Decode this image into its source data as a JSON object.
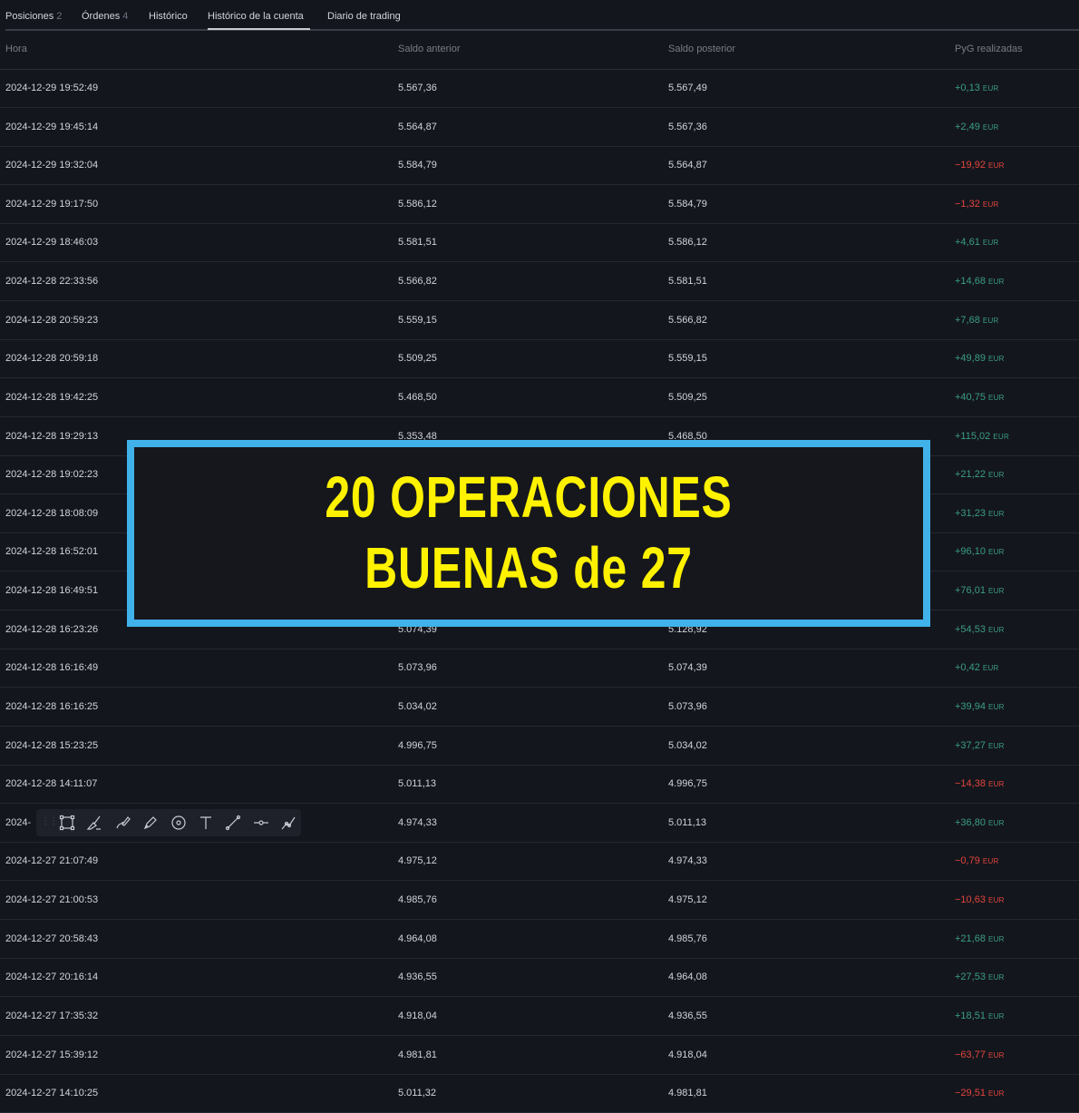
{
  "tabs": [
    {
      "label": "Posiciones",
      "count": "2"
    },
    {
      "label": "Órdenes",
      "count": "4"
    },
    {
      "label": "Histórico",
      "count": ""
    },
    {
      "label": "Histórico de la cuenta",
      "count": ""
    },
    {
      "label": "Diario de trading",
      "count": ""
    }
  ],
  "active_tab": "Histórico de la cuenta",
  "columns": [
    "Hora",
    "Saldo anterior",
    "Saldo posterior",
    "PyG realizadas"
  ],
  "currency": "EUR",
  "rows": [
    {
      "time": "2024-12-29 19:52:49",
      "before": "5.567,36",
      "after": "5.567,49",
      "pnl": "+0,13",
      "sign": "pos"
    },
    {
      "time": "2024-12-29 19:45:14",
      "before": "5.564,87",
      "after": "5.567,36",
      "pnl": "+2,49",
      "sign": "pos"
    },
    {
      "time": "2024-12-29 19:32:04",
      "before": "5.584,79",
      "after": "5.564,87",
      "pnl": "−19,92",
      "sign": "neg"
    },
    {
      "time": "2024-12-29 19:17:50",
      "before": "5.586,12",
      "after": "5.584,79",
      "pnl": "−1,32",
      "sign": "neg"
    },
    {
      "time": "2024-12-29 18:46:03",
      "before": "5.581,51",
      "after": "5.586,12",
      "pnl": "+4,61",
      "sign": "pos"
    },
    {
      "time": "2024-12-28 22:33:56",
      "before": "5.566,82",
      "after": "5.581,51",
      "pnl": "+14,68",
      "sign": "pos"
    },
    {
      "time": "2024-12-28 20:59:23",
      "before": "5.559,15",
      "after": "5.566,82",
      "pnl": "+7,68",
      "sign": "pos"
    },
    {
      "time": "2024-12-28 20:59:18",
      "before": "5.509,25",
      "after": "5.559,15",
      "pnl": "+49,89",
      "sign": "pos"
    },
    {
      "time": "2024-12-28 19:42:25",
      "before": "5.468,50",
      "after": "5.509,25",
      "pnl": "+40,75",
      "sign": "pos"
    },
    {
      "time": "2024-12-28 19:29:13",
      "before": "5.353,48",
      "after": "5.468,50",
      "pnl": "+115,02",
      "sign": "pos"
    },
    {
      "time": "2024-12-28 19:02:23",
      "before": "",
      "after": "",
      "pnl": "+21,22",
      "sign": "pos"
    },
    {
      "time": "2024-12-28 18:08:09",
      "before": "",
      "after": "",
      "pnl": "+31,23",
      "sign": "pos"
    },
    {
      "time": "2024-12-28 16:52:01",
      "before": "",
      "after": "",
      "pnl": "+96,10",
      "sign": "pos"
    },
    {
      "time": "2024-12-28 16:49:51",
      "before": "",
      "after": "",
      "pnl": "+76,01",
      "sign": "pos"
    },
    {
      "time": "2024-12-28 16:23:26",
      "before": "5.074,39",
      "after": "5.128,92",
      "pnl": "+54,53",
      "sign": "pos"
    },
    {
      "time": "2024-12-28 16:16:49",
      "before": "5.073,96",
      "after": "5.074,39",
      "pnl": "+0,42",
      "sign": "pos"
    },
    {
      "time": "2024-12-28 16:16:25",
      "before": "5.034,02",
      "after": "5.073,96",
      "pnl": "+39,94",
      "sign": "pos"
    },
    {
      "time": "2024-12-28 15:23:25",
      "before": "4.996,75",
      "after": "5.034,02",
      "pnl": "+37,27",
      "sign": "pos"
    },
    {
      "time": "2024-12-28 14:11:07",
      "before": "5.011,13",
      "after": "4.996,75",
      "pnl": "−14,38",
      "sign": "neg"
    },
    {
      "time": "2024-",
      "before": "4.974,33",
      "after": "5.011,13",
      "pnl": "+36,80",
      "sign": "pos"
    },
    {
      "time": "2024-12-27 21:07:49",
      "before": "4.975,12",
      "after": "4.974,33",
      "pnl": "−0,79",
      "sign": "neg"
    },
    {
      "time": "2024-12-27 21:00:53",
      "before": "4.985,76",
      "after": "4.975,12",
      "pnl": "−10,63",
      "sign": "neg"
    },
    {
      "time": "2024-12-27 20:58:43",
      "before": "4.964,08",
      "after": "4.985,76",
      "pnl": "+21,68",
      "sign": "pos"
    },
    {
      "time": "2024-12-27 20:16:14",
      "before": "4.936,55",
      "after": "4.964,08",
      "pnl": "+27,53",
      "sign": "pos"
    },
    {
      "time": "2024-12-27 17:35:32",
      "before": "4.918,04",
      "after": "4.936,55",
      "pnl": "+18,51",
      "sign": "pos"
    },
    {
      "time": "2024-12-27 15:39:12",
      "before": "4.981,81",
      "after": "4.918,04",
      "pnl": "−63,77",
      "sign": "neg"
    },
    {
      "time": "2024-12-27 14:10:25",
      "before": "5.011,32",
      "after": "4.981,81",
      "pnl": "−29,51",
      "sign": "neg"
    }
  ],
  "overlay": {
    "line1": "20 OPERACIONES",
    "line2": "BUENAS de 27"
  },
  "toolbar_icons": [
    "drag-handle-icon",
    "rectangle-icon",
    "brush-icon",
    "highlighter-icon",
    "pen-icon",
    "target-icon",
    "text-icon",
    "line-icon",
    "horizontal-line-icon",
    "path-icon"
  ],
  "colors": {
    "positive": "#3a9e83",
    "negative": "#e2453d",
    "overlay_text": "#fff200",
    "overlay_border": "#41b1ea",
    "background": "#14161d"
  }
}
